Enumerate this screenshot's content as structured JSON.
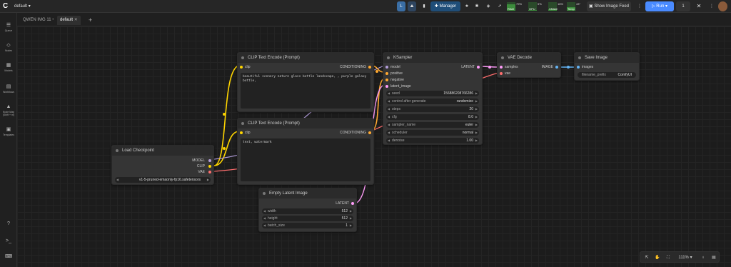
{
  "topbar": {
    "workflow_name": "default",
    "manager_label": "Manager",
    "stats": [
      {
        "name": "RAM",
        "pct": "79%",
        "level": 0.79
      },
      {
        "name": "GPU",
        "pct": "5%",
        "level": 0.05
      },
      {
        "name": "VRAM",
        "pct": "16%",
        "level": 0.16
      },
      {
        "name": "Temp",
        "pct": "43°",
        "level": 0.43
      }
    ],
    "image_feed_label": "Show Image Feed",
    "run_label": "Run",
    "queue_count": "1"
  },
  "sidebar": {
    "items": [
      {
        "icon": "☰",
        "label": "Queue"
      },
      {
        "icon": "◇",
        "label": "Nodes"
      },
      {
        "icon": "▦",
        "label": "Models"
      },
      {
        "icon": "▤",
        "label": "Workflows"
      },
      {
        "icon": "▲",
        "label": "Node Map"
      },
      {
        "icon": "▣",
        "label": "Templates"
      }
    ],
    "node_map_sub": "(Shift + m)",
    "help_icon": "?",
    "terminal_icon": ">_",
    "keyboard_icon": "⌨"
  },
  "tabs": [
    {
      "label": "QWEN IMG 11",
      "active": false
    },
    {
      "label": "default",
      "active": true
    }
  ],
  "nodes": {
    "load_checkpoint": {
      "title": "Load Checkpoint",
      "outputs": [
        "MODEL",
        "CLIP",
        "VAE"
      ],
      "ckpt_value": "v1-5-pruned-emaonly-fp16.safetensors"
    },
    "clip_pos": {
      "title": "CLIP Text Encode (Prompt)",
      "input": "clip",
      "output": "CONDITIONING",
      "text": "beautiful scenery nature glass bottle landscape, , purple galaxy bottle,"
    },
    "clip_neg": {
      "title": "CLIP Text Encode (Prompt)",
      "input": "clip",
      "output": "CONDITIONING",
      "text": "text, watermark"
    },
    "latent": {
      "title": "Empty Latent Image",
      "output": "LATENT",
      "widgets": [
        {
          "label": "width",
          "value": "512"
        },
        {
          "label": "height",
          "value": "512"
        },
        {
          "label": "batch_size",
          "value": "1"
        }
      ]
    },
    "ksampler": {
      "title": "KSampler",
      "inputs": [
        "model",
        "positive",
        "negative",
        "latent_image"
      ],
      "output": "LATENT",
      "widgets": [
        {
          "label": "seed",
          "value": "156886208766286"
        },
        {
          "label": "control after generate",
          "value": "randomize"
        },
        {
          "label": "steps",
          "value": "20"
        },
        {
          "label": "cfg",
          "value": "8.0"
        },
        {
          "label": "sampler_name",
          "value": "euler"
        },
        {
          "label": "scheduler",
          "value": "normal"
        },
        {
          "label": "denoise",
          "value": "1.00"
        }
      ]
    },
    "vae_decode": {
      "title": "VAE Decode",
      "inputs": [
        "samples",
        "vae"
      ],
      "output": "IMAGE"
    },
    "save_image": {
      "title": "Save Image",
      "input": "images",
      "prefix_label": "filename_prefix",
      "prefix_value": "ComfyUI"
    }
  },
  "bottom": {
    "zoom": "111%"
  },
  "colors": {
    "model": "#b39ddb",
    "clip": "#ffd500",
    "vae": "#ff6e6e",
    "conditioning": "#ffa931",
    "latent": "#ff9cf9",
    "image": "#64b5f6",
    "run": "#4a8bff"
  }
}
